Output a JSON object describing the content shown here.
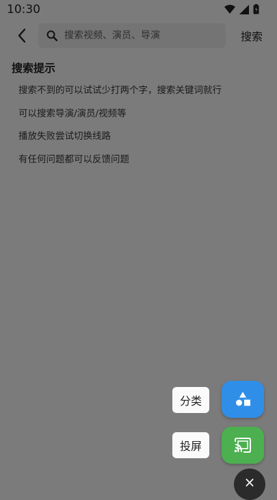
{
  "status": {
    "time": "10:30"
  },
  "search": {
    "placeholder": "搜索视频、演员、导演",
    "button_label": "搜索"
  },
  "hints": {
    "title": "搜索提示",
    "items": [
      "搜索不到的可以试试少打两个字，搜索关键词就行",
      "可以搜索导演/演员/视频等",
      "播放失败尝试切换线路",
      "有任何问题都可以反馈问题"
    ]
  },
  "fab_menu": {
    "category_label": "分类",
    "cast_label": "投屏",
    "close_symbol": "×",
    "category_color": "#2f8fe8",
    "cast_color": "#4caf50"
  },
  "icons": {
    "back": "back-arrow-icon",
    "search": "search-icon",
    "category": "shapes-icon",
    "cast": "cast-icon",
    "close": "close-icon"
  }
}
